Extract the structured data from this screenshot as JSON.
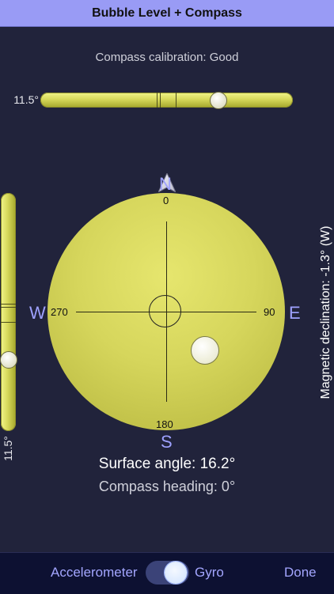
{
  "app": {
    "title": "Bubble Level + Compass"
  },
  "compass": {
    "calibration_text": "Compass calibration: Good",
    "degree_labels": {
      "north": "0",
      "east": "90",
      "south": "180",
      "west": "270"
    },
    "cardinal_labels": {
      "north": "N",
      "east": "E",
      "south": "S",
      "west": "W"
    },
    "magnetic_declination_text": "Magnetic declination: -1.3° (W)",
    "heading_text": "Compass heading: 0°"
  },
  "levels": {
    "horizontal": {
      "angle_text": "11.5°"
    },
    "vertical": {
      "angle_text": "11.5°"
    }
  },
  "surface": {
    "angle_text": "Surface angle: 16.2°"
  },
  "toolbar": {
    "left_label": "Accelerometer",
    "right_label": "Gyro",
    "done_label": "Done"
  },
  "icons": {
    "needle": "north-needle-icon"
  }
}
